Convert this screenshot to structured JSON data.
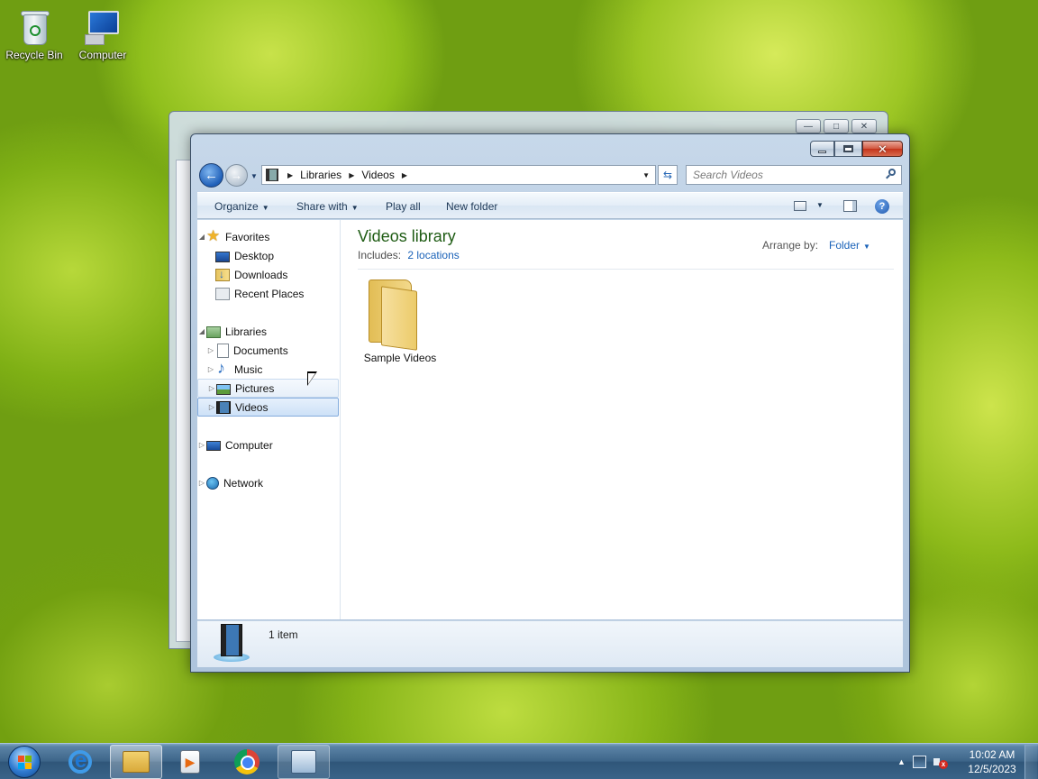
{
  "desktop": {
    "icons": [
      {
        "label": "Recycle Bin",
        "icon": "recycle-bin-icon"
      },
      {
        "label": "Computer",
        "icon": "computer-icon"
      }
    ]
  },
  "window": {
    "title": "Videos",
    "caption": {
      "minimize": "—",
      "maximize": "□",
      "close": "✕"
    },
    "address": {
      "crumbs": [
        "Libraries",
        "Videos"
      ],
      "separator": "▶"
    },
    "search": {
      "placeholder": "Search Videos"
    },
    "toolbar": {
      "organize": "Organize",
      "share_with": "Share with",
      "play_all": "Play all",
      "new_folder": "New folder",
      "dropdown_arrow": "▼",
      "help": "?"
    },
    "nav": {
      "favorites": "Favorites",
      "desktop": "Desktop",
      "downloads": "Downloads",
      "recent_places": "Recent Places",
      "libraries": "Libraries",
      "documents": "Documents",
      "music": "Music",
      "pictures": "Pictures",
      "videos": "Videos",
      "computer": "Computer",
      "network": "Network",
      "expanded_glyph": "◢",
      "collapsed_glyph": "▷"
    },
    "content": {
      "library_title": "Videos library",
      "includes_label": "Includes:",
      "includes_link": "2 locations",
      "arrange_label": "Arrange by:",
      "arrange_value": "Folder",
      "items": [
        {
          "name": "Sample Videos",
          "type": "folder"
        }
      ]
    },
    "details": {
      "item_count": "1 item"
    }
  },
  "taskbar": {
    "apps": [
      {
        "name": "Internet Explorer",
        "state": "pinned"
      },
      {
        "name": "Windows Explorer",
        "state": "active"
      },
      {
        "name": "Windows Media Player",
        "state": "pinned"
      },
      {
        "name": "Google Chrome",
        "state": "pinned"
      },
      {
        "name": "App",
        "state": "open"
      }
    ],
    "tray": {
      "expand": "▲"
    },
    "clock": {
      "time": "10:02 AM",
      "date": "12/5/2023"
    }
  },
  "colors": {
    "library_title": "#1f5c14",
    "link": "#1a62b8",
    "close_button": "#c4341b"
  }
}
